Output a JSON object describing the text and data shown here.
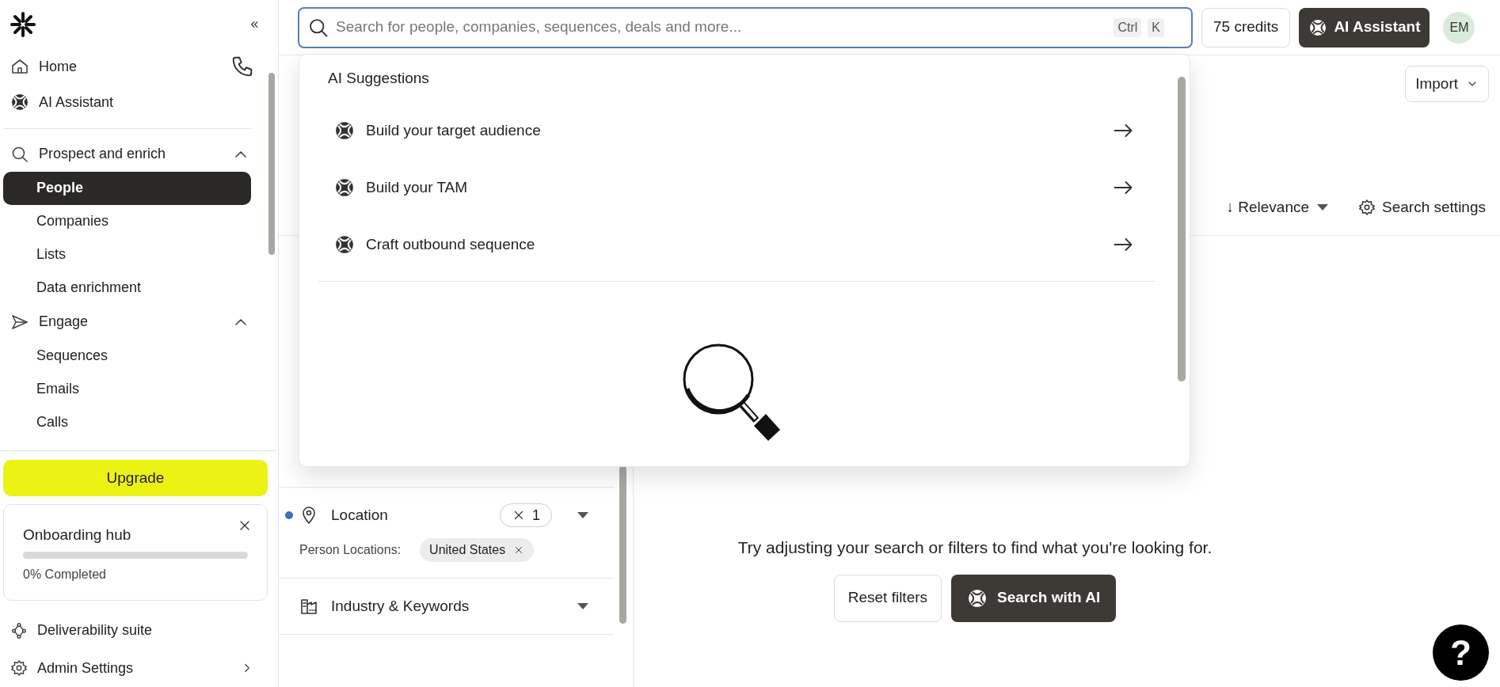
{
  "sidebar": {
    "top_items": [
      {
        "label": "Home"
      },
      {
        "label": "AI Assistant"
      }
    ],
    "sections": [
      {
        "label": "Prospect and enrich",
        "expanded": true,
        "items": [
          {
            "label": "People",
            "selected": true
          },
          {
            "label": "Companies",
            "selected": false
          },
          {
            "label": "Lists",
            "selected": false
          },
          {
            "label": "Data enrichment",
            "selected": false
          }
        ]
      },
      {
        "label": "Engage",
        "expanded": true,
        "items": [
          {
            "label": "Sequences",
            "selected": false
          },
          {
            "label": "Emails",
            "selected": false
          },
          {
            "label": "Calls",
            "selected": false
          }
        ]
      }
    ],
    "upgrade": "Upgrade",
    "onboarding": {
      "title": "Onboarding hub",
      "level": 0,
      "reading": "0% Completed"
    },
    "bottom_items": [
      {
        "label": "Deliverability suite"
      },
      {
        "label": "Admin Settings"
      }
    ]
  },
  "topbar": {
    "search": {
      "placeholder": "Search for people, companies, sequences, deals and more..."
    },
    "shortcut": [
      "Ctrl",
      "K"
    ],
    "credits": "75 credits",
    "assistant": "AI Assistant",
    "avatar": "EM"
  },
  "dropdown": {
    "heading": "AI Suggestions",
    "suggestions": [
      {
        "label": "Build your target audience"
      },
      {
        "label": "Build your TAM"
      },
      {
        "label": "Craft outbound sequence"
      }
    ]
  },
  "header": {
    "import": "Import",
    "sort": "↓ Relevance",
    "settings": "Search settings"
  },
  "filters": [
    {
      "label": "Location",
      "active": true,
      "count": "1",
      "values_label": "Person Locations:",
      "values": [
        "United States"
      ]
    },
    {
      "label": "Industry & Keywords",
      "active": false
    }
  ],
  "results": {
    "message": "Try adjusting your search or filters to find what you're looking for.",
    "reset": "Reset filters",
    "search_ai": "Search with AI"
  },
  "help": "?"
}
